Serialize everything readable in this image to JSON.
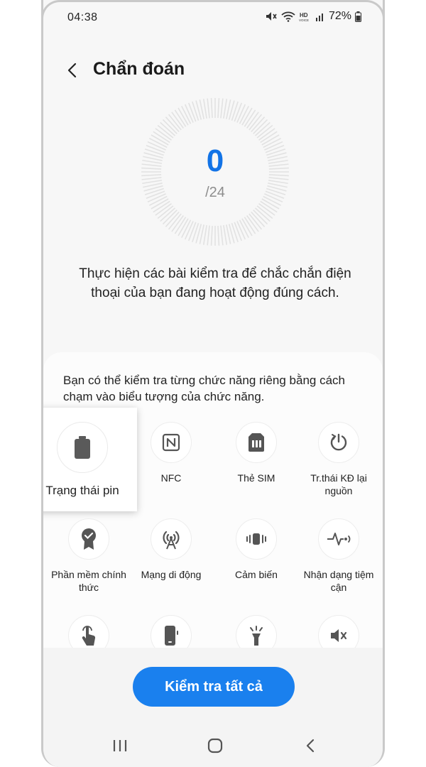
{
  "status_bar": {
    "time": "04:38",
    "battery_percent": "72%"
  },
  "header": {
    "title": "Chẩn đoán"
  },
  "progress": {
    "score": "0",
    "total": "/24"
  },
  "intro_text": "Thực hiện các bài kiểm tra để chắc chắn điện thoại của bạn đang hoạt động đúng cách.",
  "card": {
    "description": "Bạn có thể kiểm tra từng chức năng riêng bằng cách chạm vào biểu tượng của chức năng.",
    "tests": [
      {
        "label": "Trạng thái pin",
        "icon": "battery-icon"
      },
      {
        "label": "NFC",
        "icon": "nfc-icon"
      },
      {
        "label": "Thẻ SIM",
        "icon": "sim-card-icon"
      },
      {
        "label": "Tr.thái KĐ lại nguồn",
        "icon": "restart-icon"
      },
      {
        "label": "Phần mềm chính thức",
        "icon": "certified-badge-icon"
      },
      {
        "label": "Mạng di động",
        "icon": "cell-tower-icon"
      },
      {
        "label": "Cảm biến",
        "icon": "vibration-sensor-icon"
      },
      {
        "label": "Nhận dạng tiệm cận",
        "icon": "proximity-icon"
      },
      {
        "label": "",
        "icon": "touch-icon"
      },
      {
        "label": "",
        "icon": "phone-device-icon"
      },
      {
        "label": "",
        "icon": "flashlight-icon"
      },
      {
        "label": "",
        "icon": "speaker-mute-icon"
      }
    ]
  },
  "actions": {
    "test_all": "Kiểm tra tất cả"
  },
  "colors": {
    "accent": "#1a80ee",
    "score": "#1273e6",
    "icon": "#555555"
  }
}
